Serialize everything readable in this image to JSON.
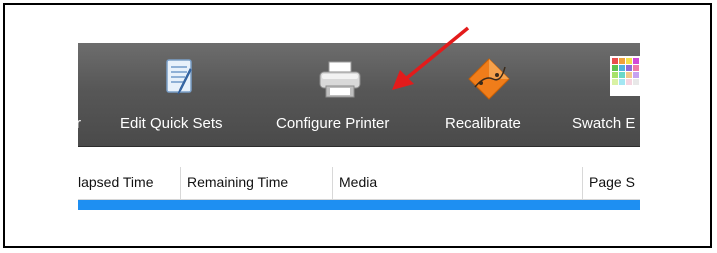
{
  "toolbar": {
    "items": [
      {
        "label": "Edit Quick Sets",
        "icon": "edit-quick-sets-icon"
      },
      {
        "label": "Configure Printer",
        "icon": "printer-icon"
      },
      {
        "label": "Recalibrate",
        "icon": "recalibrate-icon"
      },
      {
        "label": "Swatch E",
        "icon": "swatch-icon"
      }
    ]
  },
  "table": {
    "columns": [
      "lapsed Time",
      "Remaining Time",
      "Media",
      "Page S"
    ]
  },
  "colors": {
    "toolbar_bg": "#555555",
    "selection": "#1e8ff2",
    "arrow": "#e31b1b"
  }
}
